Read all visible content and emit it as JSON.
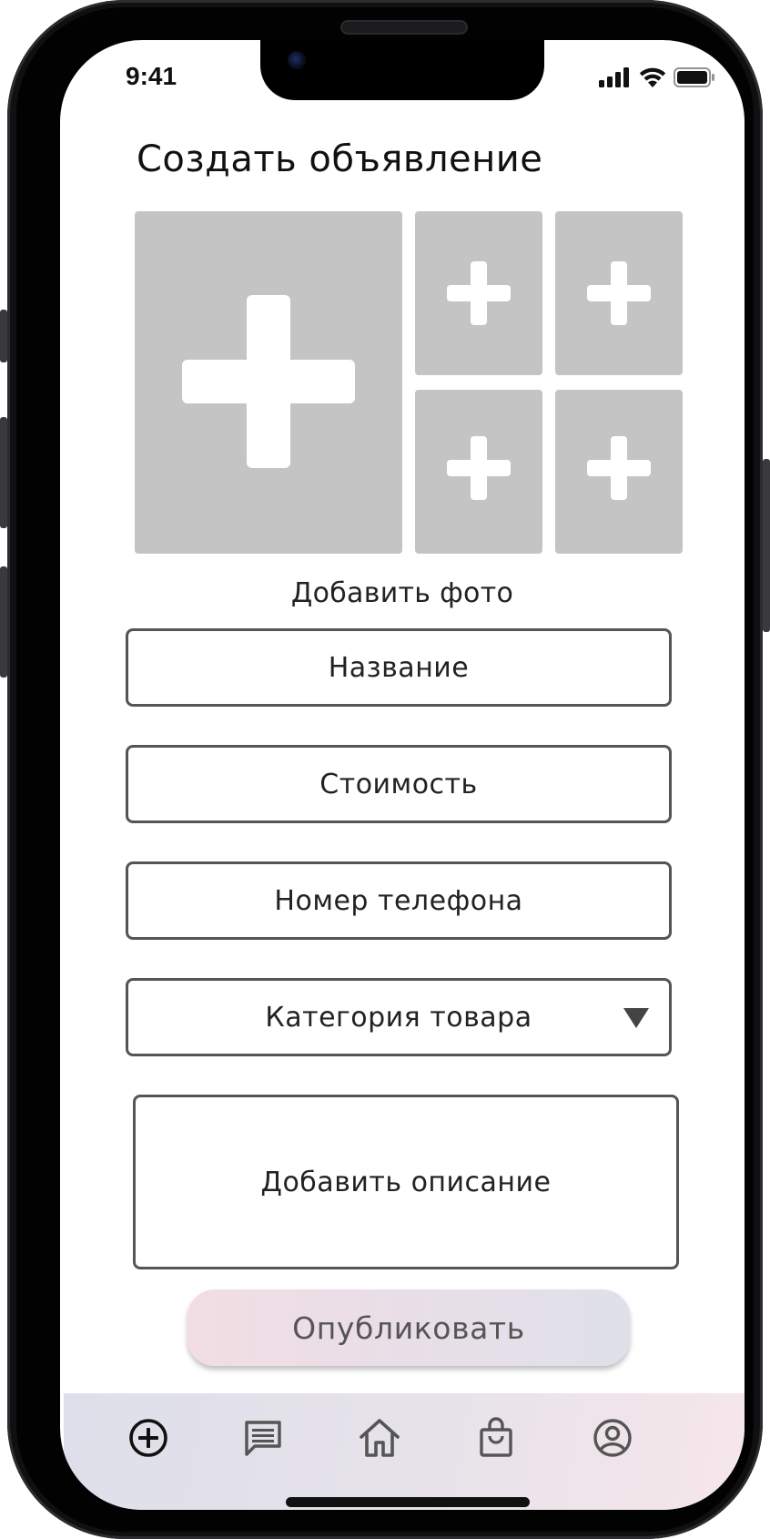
{
  "status_bar": {
    "time": "9:41",
    "icons": [
      "signal-icon",
      "wifi-icon",
      "battery-icon"
    ]
  },
  "page": {
    "title": "Создать объявление"
  },
  "photos": {
    "add_label": "Добавить фото",
    "slot_icon": "plus-icon",
    "slot_color": "#c4c4c4"
  },
  "form": {
    "name_placeholder": "Название",
    "price_placeholder": "Стоимость",
    "phone_placeholder": "Номер телефона",
    "category_placeholder": "Категория товара",
    "description_placeholder": "Добавить описание"
  },
  "actions": {
    "publish_label": "Опубликовать"
  },
  "tabbar": {
    "items": [
      {
        "icon": "add-circle-icon",
        "active": true
      },
      {
        "icon": "chat-icon",
        "active": false
      },
      {
        "icon": "home-icon",
        "active": false
      },
      {
        "icon": "shopping-bag-icon",
        "active": false
      },
      {
        "icon": "profile-icon",
        "active": false
      }
    ]
  },
  "colors": {
    "field_border": "#555555",
    "publish_gradient_start": "#f2dde4",
    "publish_gradient_end": "#dfe0ea"
  }
}
